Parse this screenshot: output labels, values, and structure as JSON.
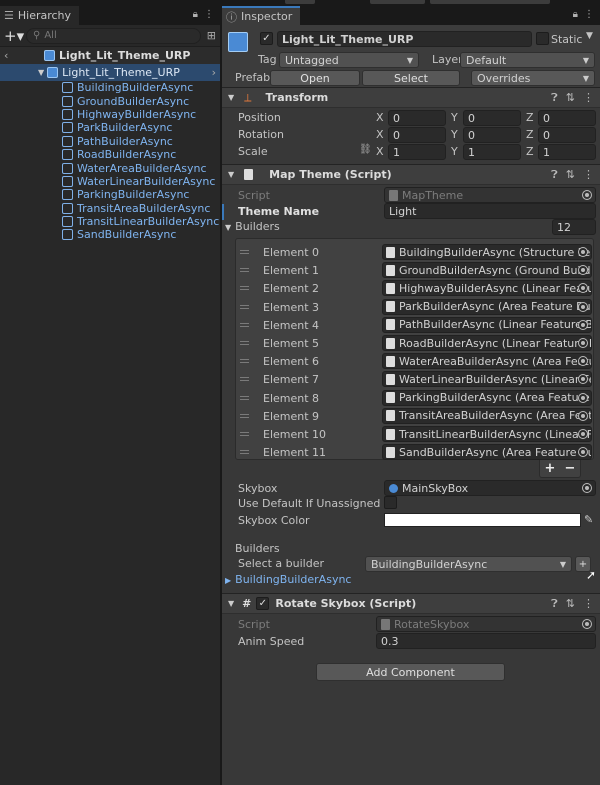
{
  "hierarchy": {
    "tab_label": "Hierarchy",
    "search_placeholder": "All",
    "scene_name": "Light_Lit_Theme_URP",
    "root_object": "Light_Lit_Theme_URP",
    "children": [
      "BuildingBuilderAsync",
      "GroundBuilderAsync",
      "HighwayBuilderAsync",
      "ParkBuilderAsync",
      "PathBuilderAsync",
      "RoadBuilderAsync",
      "WaterAreaBuilderAsync",
      "WaterLinearBuilderAsync",
      "ParkingBuilderAsync",
      "TransitAreaBuilderAsync",
      "TransitLinearBuilderAsync",
      "SandBuilderAsync"
    ]
  },
  "inspector": {
    "tab_label": "Inspector",
    "object_name": "Light_Lit_Theme_URP",
    "static_label": "Static",
    "tag_label": "Tag",
    "tag_value": "Untagged",
    "layer_label": "Layer",
    "layer_value": "Default",
    "prefab_label": "Prefab",
    "open_label": "Open",
    "select_label": "Select",
    "overrides_label": "Overrides"
  },
  "transform": {
    "title": "Transform",
    "rows": [
      {
        "label": "Position",
        "x": "0",
        "y": "0",
        "z": "0"
      },
      {
        "label": "Rotation",
        "x": "0",
        "y": "0",
        "z": "0"
      },
      {
        "label": "Scale",
        "x": "1",
        "y": "1",
        "z": "1"
      }
    ],
    "x_label": "X",
    "y_label": "Y",
    "z_label": "Z"
  },
  "map_theme": {
    "title": "Map Theme (Script)",
    "script_label": "Script",
    "script_value": "MapTheme",
    "theme_name_label": "Theme Name",
    "theme_name_value": "Light",
    "builders_label": "Builders",
    "builders_count": "12",
    "elements": [
      {
        "label": "Element 0",
        "value": "BuildingBuilderAsync (Structure Feature Builder Async)"
      },
      {
        "label": "Element 1",
        "value": "GroundBuilderAsync (Ground Builder Async)"
      },
      {
        "label": "Element 2",
        "value": "HighwayBuilderAsync (Linear Feature Builder Async)"
      },
      {
        "label": "Element 3",
        "value": "ParkBuilderAsync (Area Feature Builder Async)"
      },
      {
        "label": "Element 4",
        "value": "PathBuilderAsync (Linear Feature Builder Async)"
      },
      {
        "label": "Element 5",
        "value": "RoadBuilderAsync (Linear Feature Builder Async)"
      },
      {
        "label": "Element 6",
        "value": "WaterAreaBuilderAsync (Area Feature Builder Async)"
      },
      {
        "label": "Element 7",
        "value": "WaterLinearBuilderAsync (Linear Feature Builder Async)"
      },
      {
        "label": "Element 8",
        "value": "ParkingBuilderAsync (Area Feature Builder Async)"
      },
      {
        "label": "Element 9",
        "value": "TransitAreaBuilderAsync (Area Feature Builder Async)"
      },
      {
        "label": "Element 10",
        "value": "TransitLinearBuilderAsync (Linear Feature Builder Async)"
      },
      {
        "label": "Element 11",
        "value": "SandBuilderAsync (Area Feature Builder Async)"
      }
    ],
    "add_label": "+",
    "remove_label": "−",
    "skybox_label": "Skybox",
    "skybox_value": "MainSkyBox",
    "use_default_label": "Use Default If Unassigned",
    "skybox_color_label": "Skybox Color",
    "builders_section_label": "Builders",
    "select_builder_label": "Select a builder",
    "select_builder_value": "BuildingBuilderAsync",
    "builder_foldout": "BuildingBuilderAsync"
  },
  "rotate_skybox": {
    "title": "Rotate Skybox (Script)",
    "script_label": "Script",
    "script_value": "RotateSkybox",
    "anim_speed_label": "Anim Speed",
    "anim_speed_value": "0.3"
  },
  "add_component_label": "Add Component",
  "colors": {
    "accent": "#3a79bb",
    "link": "#7fb4f0",
    "panel": "#383838",
    "field": "#2a2a2a"
  }
}
